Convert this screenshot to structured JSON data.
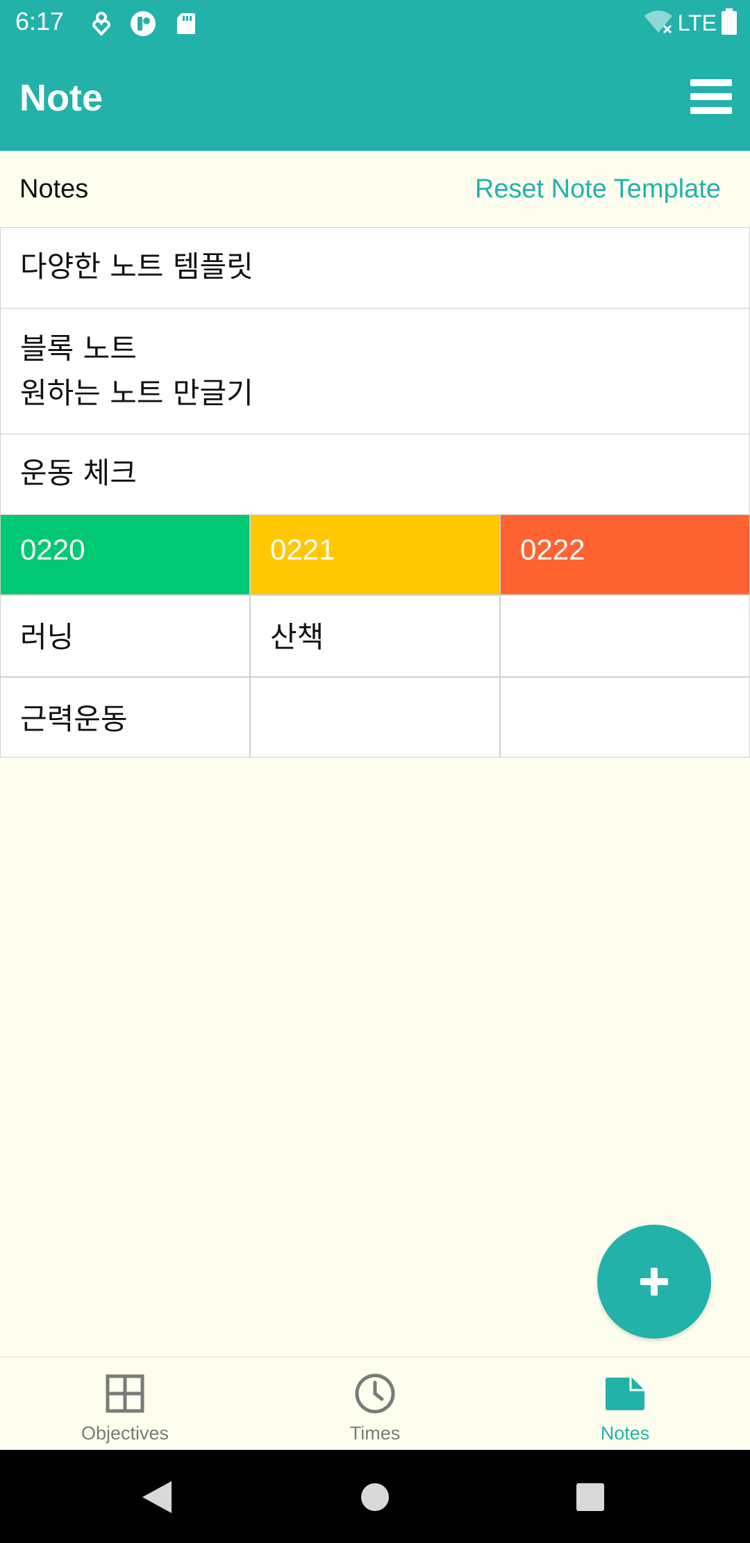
{
  "status_bar": {
    "time": "6:17",
    "network": "LTE",
    "icons": [
      "location-heart-icon",
      "pocket-app-icon",
      "sd-card-icon",
      "wifi-off-icon",
      "battery-icon"
    ]
  },
  "app_bar": {
    "title": "Note",
    "menu_icon": "hamburger-menu-icon"
  },
  "notes_header": {
    "title": "Notes",
    "reset_label": "Reset Note Template"
  },
  "blocks": [
    {
      "lines": [
        "다양한 노트 템플릿"
      ]
    },
    {
      "lines": [
        "블록 노트",
        "원하는 노트 만글기"
      ]
    },
    {
      "lines": [
        "운동 체크"
      ]
    }
  ],
  "exercise_table": {
    "headers": [
      {
        "label": "0220",
        "color": "#00c874"
      },
      {
        "label": "0221",
        "color": "#ffc800"
      },
      {
        "label": "0222",
        "color": "#ff6332"
      }
    ],
    "rows": [
      [
        "러닝",
        "산책",
        ""
      ],
      [
        "근력운동",
        "",
        ""
      ]
    ]
  },
  "fab": {
    "icon": "plus-icon"
  },
  "bottom_nav": {
    "items": [
      {
        "label": "Objectives",
        "icon": "grid-icon",
        "active": false
      },
      {
        "label": "Times",
        "icon": "clock-icon",
        "active": false
      },
      {
        "label": "Notes",
        "icon": "note-icon",
        "active": true
      }
    ]
  },
  "colors": {
    "primary": "#22b2aa",
    "background": "#fefeee",
    "inactive": "#7a7a7a"
  }
}
